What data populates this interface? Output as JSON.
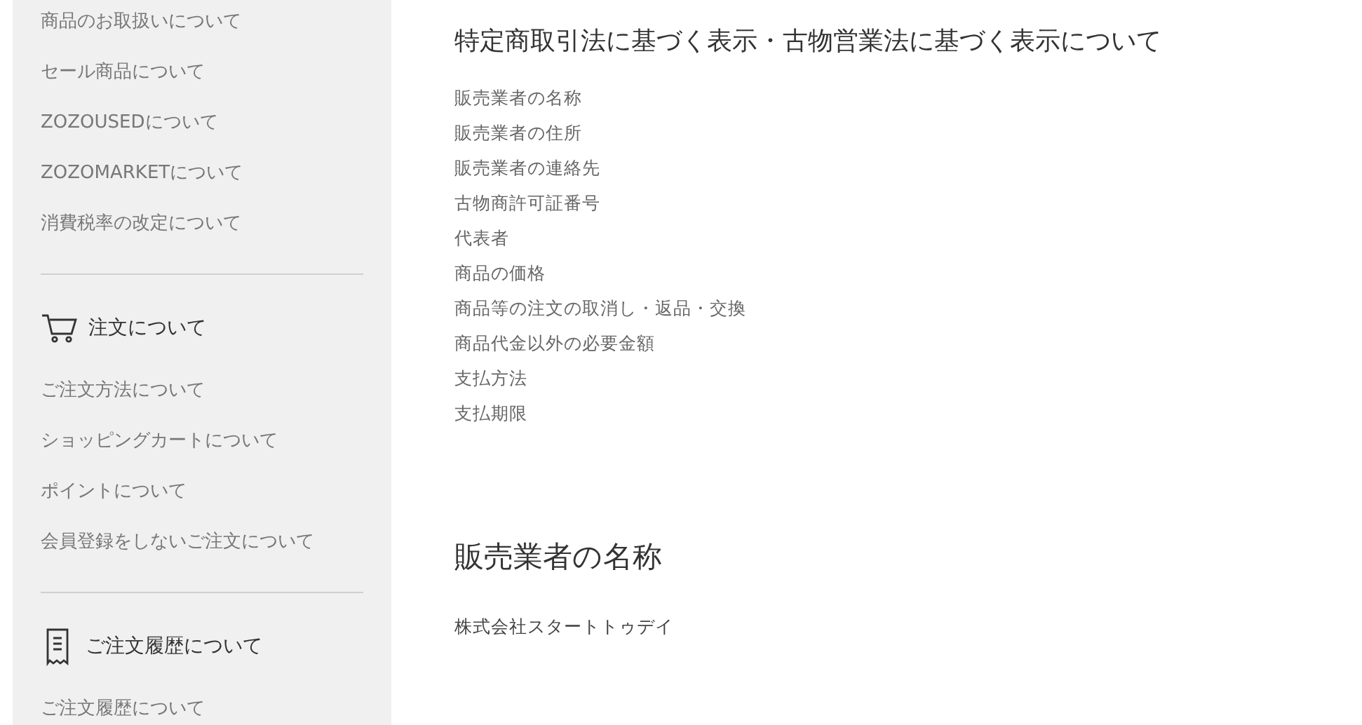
{
  "sidebar": {
    "sections": [
      {
        "items": [
          "商品のお取扱いについて",
          "セール商品について",
          "ZOZOUSEDについて",
          "ZOZOMARKETについて",
          "消費税率の改定について"
        ]
      },
      {
        "title": "注文について",
        "kind": "cart",
        "items": [
          "ご注文方法について",
          "ショッピングカートについて",
          "ポイントについて",
          "会員登録をしないご注文について"
        ]
      },
      {
        "title": "ご注文履歴について",
        "kind": "receipt",
        "items": [
          "ご注文履歴について"
        ]
      }
    ]
  },
  "main": {
    "title": "特定商取引法に基づく表示・古物営業法に基づく表示について",
    "links": [
      "販売業者の名称",
      "販売業者の住所",
      "販売業者の連絡先",
      "古物商許可証番号",
      "代表者",
      "商品の価格",
      "商品等の注文の取消し・返品・交換",
      "商品代金以外の必要金額",
      "支払方法",
      "支払期限"
    ],
    "sections": [
      {
        "heading": "販売業者の名称",
        "body": "株式会社スタートトゥデイ"
      }
    ]
  }
}
